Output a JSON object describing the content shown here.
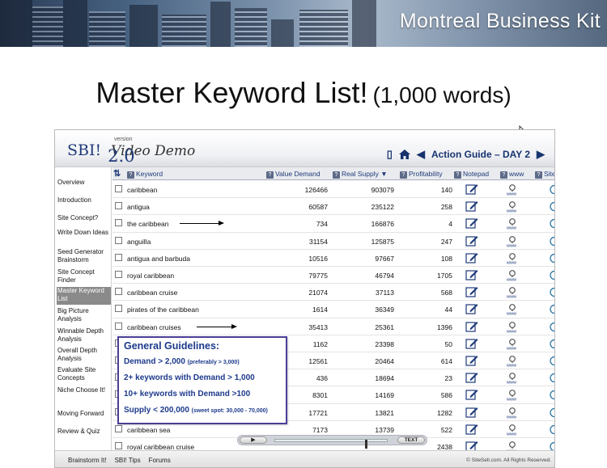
{
  "banner": {
    "title": "Montreal Business Kit"
  },
  "heading": {
    "main": "Master Keyword List!",
    "sub": "(1,000 words)"
  },
  "app": {
    "logo_main": "SBI! ",
    "logo_version_label": "version",
    "logo_version": "2.0",
    "logo_sub": "Video Demo",
    "nav_label": "Action Guide – DAY 2"
  },
  "sidebar": {
    "items": [
      {
        "label": "Overview"
      },
      {
        "label": "Introduction"
      },
      {
        "label": "Site Concept?"
      },
      {
        "label": "Write Down Ideas"
      },
      {
        "label": "Seed Generator Brainstorm"
      },
      {
        "label": "Site Concept Finder"
      },
      {
        "label": "Master Keyword List"
      },
      {
        "label": "Big Picture Analysis"
      },
      {
        "label": "Winnable Depth Analysis"
      },
      {
        "label": "Overall Depth Analysis"
      },
      {
        "label": "Evaluate Site Concepts"
      },
      {
        "label": "Niche Choose It!"
      },
      {
        "label": "Moving Forward"
      },
      {
        "label": "Review & Quiz"
      }
    ]
  },
  "table": {
    "headers": {
      "keyword": "Keyword",
      "value_demand": "Value Demand",
      "real_supply": "Real Supply",
      "profitability": "Profitability",
      "notepad": "Notepad",
      "www": "www",
      "site": "Site"
    },
    "rows": [
      {
        "keyword": "caribbean",
        "demand": "126466",
        "supply": "903079",
        "profit": "140"
      },
      {
        "keyword": "antigua",
        "demand": "60587",
        "supply": "235122",
        "profit": "258"
      },
      {
        "keyword": "the caribbean",
        "demand": "734",
        "supply": "166876",
        "profit": "4"
      },
      {
        "keyword": "anguilla",
        "demand": "31154",
        "supply": "125875",
        "profit": "247"
      },
      {
        "keyword": "antigua and barbuda",
        "demand": "10516",
        "supply": "97667",
        "profit": "108"
      },
      {
        "keyword": "royal caribbean",
        "demand": "79775",
        "supply": "46794",
        "profit": "1705"
      },
      {
        "keyword": "caribbean cruise",
        "demand": "21074",
        "supply": "37113",
        "profit": "568"
      },
      {
        "keyword": "pirates of the caribbean",
        "demand": "1614",
        "supply": "36349",
        "profit": "44"
      },
      {
        "keyword": "caribbean cruises",
        "demand": "35413",
        "supply": "25361",
        "profit": "1396"
      },
      {
        "keyword": "",
        "demand": "1162",
        "supply": "23398",
        "profit": "50"
      },
      {
        "keyword": "",
        "demand": "12561",
        "supply": "20464",
        "profit": "614"
      },
      {
        "keyword": "",
        "demand": "436",
        "supply": "18694",
        "profit": "23"
      },
      {
        "keyword": "",
        "demand": "8301",
        "supply": "14169",
        "profit": "586"
      },
      {
        "keyword": "",
        "demand": "17721",
        "supply": "13821",
        "profit": "1282"
      },
      {
        "keyword": "caribbean sea",
        "demand": "7173",
        "supply": "13739",
        "profit": "522"
      },
      {
        "keyword": "royal caribbean cruise",
        "demand": "",
        "supply": "",
        "profit": "2438"
      }
    ]
  },
  "guidelines": {
    "title": "General Guidelines:",
    "line1": "Demand > 2,000",
    "line1_small": "(preferably > 3,000)",
    "line2": "2+ keywords with Demand > 1,000",
    "line3": "10+ keywords with Demand >100",
    "line4": "Supply < 200,000",
    "line4_small": "(sweet spot: 30,000 - 70,000)"
  },
  "player": {
    "play_label": "▶",
    "text_label": "TEXT",
    "progress": 0.8
  },
  "footer": {
    "links": [
      "Brainstorm It!",
      "SBI! Tips",
      "Forums"
    ],
    "copyright": "© SiteSell.com. All Rights Reserved."
  },
  "icons": {
    "notepad": "notepad-icon",
    "www": "www-search-icon",
    "phone": "phone-icon",
    "home": "home-icon"
  }
}
